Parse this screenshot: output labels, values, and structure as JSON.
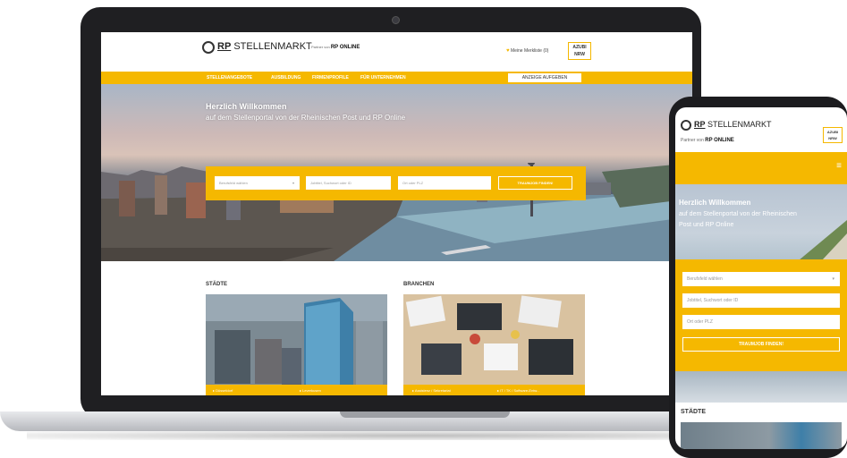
{
  "site": {
    "logo_rp": "RP",
    "logo_name": "STELLENMARKT",
    "partner_prefix": "Partner von",
    "partner_name": "RP ONLINE",
    "merkliste": "Meine Merkliste (0)",
    "azubi_line1": "AZUBI",
    "azubi_line2": "NRW"
  },
  "nav": {
    "items": [
      "STELLENANGEBOTE",
      "AUSBILDUNG",
      "FIRMENPROFILE",
      "FÜR UNTERNEHMEN"
    ],
    "cta": "ANZEIGE AUFGEBEN"
  },
  "hero": {
    "title": "Herzlich Willkommen",
    "subtitle": "auf dem Stellenportal von der Rheinischen Post und RP Online"
  },
  "search": {
    "field_category": "Berufsfeld wählen",
    "field_keyword": "Jobtitel, Suchwort oder ID",
    "field_location": "Ort oder PLZ",
    "button": "TRAUMJOB FINDEN!"
  },
  "sections": {
    "staedte": {
      "label": "STÄDTE",
      "links": [
        "Düsseldorf",
        "Leverkusen"
      ]
    },
    "branchen": {
      "label": "BRANCHEN",
      "links": [
        "Assistenz / Sekretariat",
        "IT / TK / Software-Entw..."
      ]
    }
  },
  "phone": {
    "logo_rp": "RP",
    "logo_name": "STELLENMARKT",
    "partner_prefix": "Partner von",
    "partner_name": "RP ONLINE",
    "azubi_line1": "AZUBI",
    "azubi_line2": "NRW",
    "hero_title": "Herzlich Willkommen",
    "hero_subtitle_1": "auf dem Stellenportal von der Rheinischen",
    "hero_subtitle_2": "Post und RP Online",
    "field_category": "Berufsfeld wählen",
    "field_keyword": "Jobtitel, Suchwort oder ID",
    "field_location": "Ort oder PLZ",
    "button": "TRAUMJOB FINDEN!",
    "section_label": "STÄDTE"
  },
  "colors": {
    "accent": "#f5b800",
    "device_frame": "#1f1f22"
  }
}
